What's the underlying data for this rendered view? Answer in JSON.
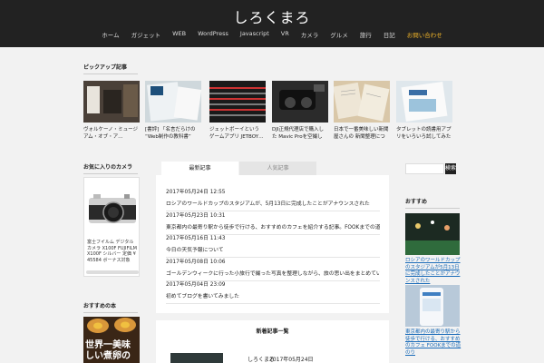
{
  "header": {
    "site_title": "しろくまろ",
    "nav": [
      "ホーム",
      "ガジェット",
      "WEB",
      "WordPress",
      "Javascript",
      "VR",
      "カメラ",
      "グルメ",
      "旅行",
      "日記",
      "お問い合わせ"
    ]
  },
  "featured": {
    "heading": "ピックアップ記事",
    "items": [
      {
        "caption": "ヴォルケーノ・ミュージアム・オブ・ア…"
      },
      {
        "caption": "[書評] 「名言だらけの “Web制作の教科書” は…"
      },
      {
        "caption": "ジェットボーイという ゲームアプリ JETBOY…"
      },
      {
        "caption": "DJI正規代理店で購入した Mavic Proを空撮して…"
      },
      {
        "caption": "日本で一番美味しい新聞屋さんの 新聞整理について…"
      },
      {
        "caption": "タブレットの読書用アプリをいろいろ試してみた 感想について…"
      }
    ]
  },
  "left_sidebar": {
    "camera_heading": "お気に入りのカメラ",
    "camera_text": "富士フイルム デジタルカメラ X100F FUJIFILM X100F シルバー 定価 ¥ 45584 ボーナス対象",
    "book_heading": "おすすめの本",
    "book_cover_text": "世界一美味しい煮卵の"
  },
  "tabs": {
    "active": "最新記事",
    "inactive": "人気記事"
  },
  "posts": [
    {
      "date": "2017年05月24日 12:55",
      "title": "ロシアのワールドカップのスタジアムが、5月13日に完成したことがアナウンスされた"
    },
    {
      "date": "2017年05月23日 10:31",
      "title": "東京都内の最寄り駅から徒歩で行ける、おすすめのカフェを紹介する記事。FOOKまでの道のり"
    },
    {
      "date": "2017年05月16日 11:43",
      "title": "今日の天気予報について"
    },
    {
      "date": "2017年05月08日 10:06",
      "title": "ゴールデンウィークに行った小旅行で撮った写真を整理しながら、旅の思い出をまとめていく"
    },
    {
      "date": "2017年05月04日 23:09",
      "title": "初めてブログを書いてみました"
    }
  ],
  "bottom_section": {
    "heading": "新着記事一覧",
    "item_label": "しろくまろ",
    "item_date": "2017年05月24日"
  },
  "right_sidebar": {
    "search_button": "検索",
    "recommend_heading": "おすすめ",
    "links": [
      "ロシアのワールドカップのスタジアムが5月13日に完成したことがアナウンスされた",
      "東京都内の最寄り駅から徒歩で行ける、おすすめのカフェ FOOKまでの道のり"
    ]
  }
}
